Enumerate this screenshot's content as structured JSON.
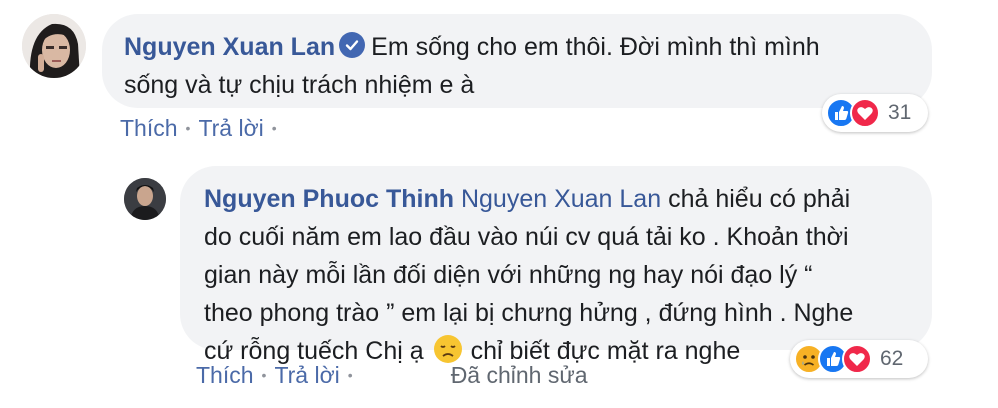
{
  "comments": [
    {
      "author": "Nguyen Xuan Lan",
      "verified": true,
      "line1": "Em sống cho em thôi. Đời mình thì mình",
      "line2": "sống và tự chịu trách nhiệm e à",
      "reaction_icons": [
        "like-icon",
        "love-icon"
      ],
      "reaction_count": "31",
      "actions": {
        "like": "Thích",
        "reply": "Trả lời"
      }
    },
    {
      "author": "Nguyen Phuoc Thinh",
      "mention": "Nguyen Xuan Lan",
      "line1_rest": "chả hiểu có phải",
      "line2": "do cuối năm em lao đầu vào núi cv quá tải ko . Khoản thời",
      "line3": "gian này mỗi lần đối diện với những ng hay nói đạo lý “",
      "line4": "theo phong trào ” em lại bị chưng hửng , đứng hình . Nghe",
      "line5_a": "cứ rỗng tuếch Chị ạ",
      "line5_b": "chỉ biết đực mặt ra nghe",
      "inline_emoji": "disappointed-face-icon",
      "reaction_icons": [
        "sad-icon",
        "like-icon",
        "love-icon"
      ],
      "reaction_count": "62",
      "actions": {
        "like": "Thích",
        "reply": "Trả lời",
        "edited": "Đã chỉnh sửa"
      }
    }
  ],
  "colors": {
    "name": "#385898",
    "bubble": "#f2f3f5",
    "like": "#1877f2",
    "love": "#f0284a",
    "sad": "#f7b125"
  }
}
